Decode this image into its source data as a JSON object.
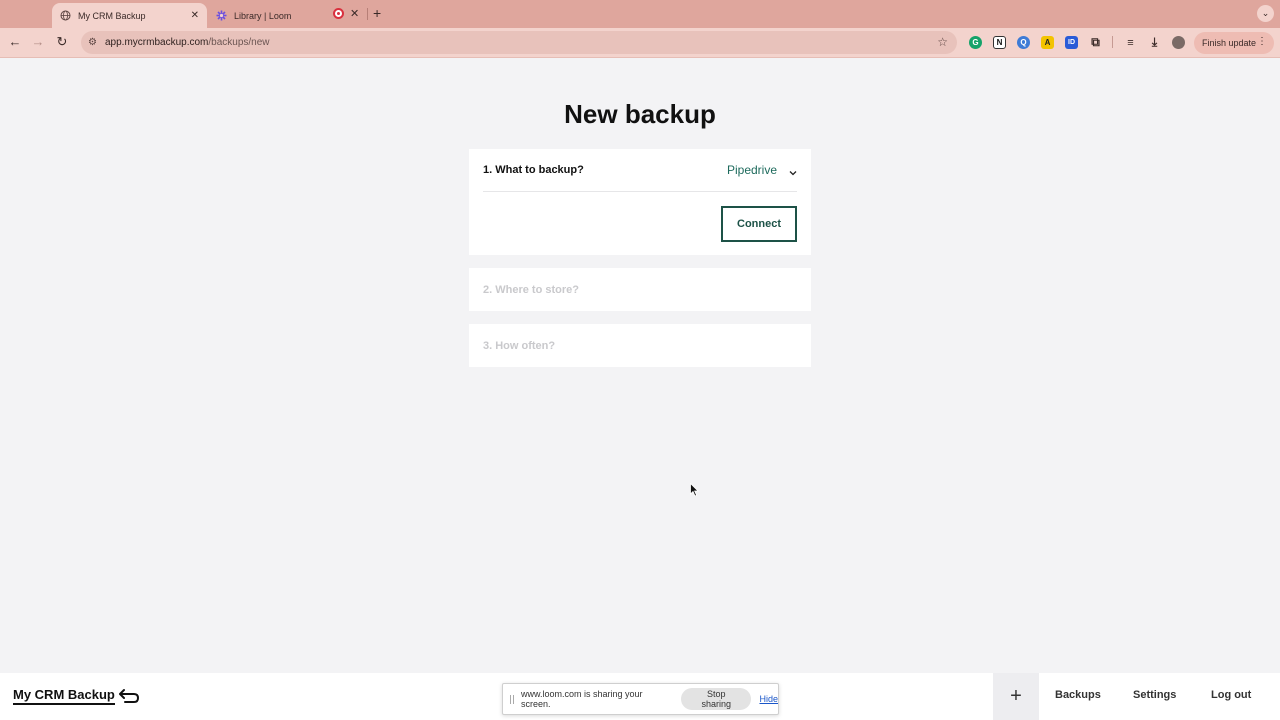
{
  "browser": {
    "tabs": [
      {
        "title": "My CRM Backup",
        "active": true
      },
      {
        "title": "Library | Loom",
        "active": false
      }
    ],
    "new_tab_label": "+",
    "url_host": "app.mycrmbackup.com",
    "url_path": "/backups/new",
    "finish_update": "Finish update",
    "extension_icons": [
      "grammarly-icon",
      "notion-icon",
      "magnifier-extension-icon",
      "warning-extension-icon",
      "id-extension-icon",
      "puzzle-icon"
    ]
  },
  "page": {
    "title": "New backup",
    "steps": [
      {
        "label": "1. What to backup?",
        "active": true,
        "selected_value": "Pipedrive",
        "action_label": "Connect"
      },
      {
        "label": "2. Where to store?",
        "active": false
      },
      {
        "label": "3. How often?",
        "active": false
      }
    ],
    "accent_color": "#1d6a5c"
  },
  "footer": {
    "brand": "My CRM Backup",
    "add_label": "+",
    "nav": [
      "Backups",
      "Settings",
      "Log out"
    ]
  },
  "loom_bar": {
    "message": "www.loom.com is sharing your screen.",
    "stop_label": "Stop sharing",
    "hide_label": "Hide"
  }
}
